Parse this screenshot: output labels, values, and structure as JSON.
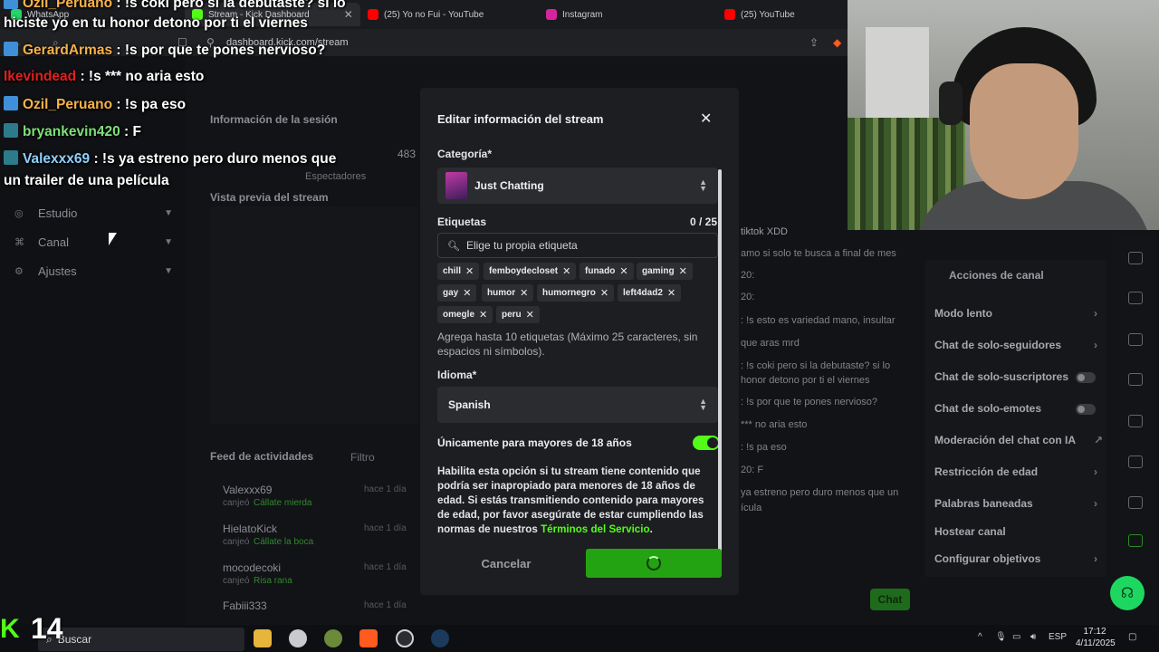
{
  "browser": {
    "tabs": [
      {
        "label": "WhatsApp",
        "color": "#25d366"
      },
      {
        "label": "Stream - Kick Dashboard",
        "color": "#53fc18"
      },
      {
        "label": "(25) Yo no Fui - YouTube",
        "color": "#ff0000"
      },
      {
        "label": "Instagram",
        "color": "#d6249f"
      },
      {
        "label": "(25) YouTube",
        "color": "#ff0000"
      }
    ],
    "url": "dashboard.kick.com/stream"
  },
  "overlay_chat": [
    {
      "user": "Ozil_Peruano",
      "user_color": "#f7b24a",
      "msg": ": !s coki pero si la debutaste? si lo",
      "badge": "blue"
    },
    {
      "cont": "hiciste yo en tu honor detono por ti el viernes"
    },
    {
      "user": "GerardArmas",
      "user_color": "#f7b24a",
      "msg": ": !s por que te pones nervioso?",
      "badge": "blue"
    },
    {
      "user": "Ikevindead",
      "user_color": "#e02020",
      "msg": ": !s *** no aria esto",
      "badge": ""
    },
    {
      "user": "Ozil_Peruano",
      "user_color": "#f7b24a",
      "msg": ": !s pa eso",
      "badge": "blue"
    },
    {
      "user": "bryankevin420",
      "user_color": "#7de07a",
      "msg": ": F",
      "badge": "teal"
    },
    {
      "user": "Valexxx69",
      "user_color": "#8fd0ff",
      "msg": ": !s ya estreno pero duro menos que",
      "badge": "teal"
    },
    {
      "cont": "un trailer de una película"
    }
  ],
  "dashboard": {
    "section_info": "Información de la sesión",
    "section_preview": "Vista previa del stream",
    "sidebar": [
      {
        "label": "Estudio"
      },
      {
        "label": "Canal"
      },
      {
        "label": "Ajustes"
      }
    ],
    "stats": {
      "viewers": "483",
      "label_spectators": "Espectadores"
    },
    "activity_title": "Feed de actividades",
    "activity_filter": "Filtro",
    "activity": [
      {
        "user": "Valexxx69",
        "action": "canjeó",
        "item": "Cállate mierda",
        "time": "hace 1 día"
      },
      {
        "user": "HielatoKick",
        "action": "canjeó",
        "item": "Cállate la boca",
        "time": "hace 1 día"
      },
      {
        "user": "mocodecoki",
        "action": "canjeó",
        "item": "Risa rana",
        "time": "hace 1 día"
      },
      {
        "user": "Fabiii333",
        "action": "",
        "item": "",
        "time": "hace 1 día"
      }
    ],
    "channel_actions_title": "Acciones de canal",
    "channel_actions": [
      {
        "label": "Modo lento",
        "type": "chevron"
      },
      {
        "label": "Chat de solo-seguidores",
        "type": "chevron"
      },
      {
        "label": "Chat de solo-suscriptores",
        "type": "toggle"
      },
      {
        "label": "Chat de solo-emotes",
        "type": "toggle"
      },
      {
        "label": "Moderación del chat con IA",
        "type": "link"
      },
      {
        "label": "Restricción de edad",
        "type": "chevron"
      },
      {
        "label": "Palabras baneadas",
        "type": "chevron"
      },
      {
        "label": "Hostear canal",
        "type": "none"
      },
      {
        "label": "Configurar objetivos",
        "type": "chevron"
      }
    ],
    "chat_lines": [
      "tiktok XDD",
      "amo si solo te busca a final de mes",
      "20:",
      "20:",
      ": !s esto es variedad mano, insultar",
      "que aras mrd",
      ": !s coki pero si la debutaste? si lo",
      "honor detono por ti el viernes",
      ": !s por que te pones nervioso?",
      "*** no aria esto",
      ": !s pa eso",
      "20: F",
      "ya estreno pero duro menos que un",
      "ícula"
    ],
    "chat_button": "Chat",
    "big_count": "14"
  },
  "modal": {
    "title": "Editar información del stream",
    "category_label": "Categoría*",
    "category_value": "Just Chatting",
    "tags_label": "Etiquetas",
    "tags_count": "0 / 25",
    "tags_placeholder": "Elige tu propia etiqueta",
    "tags": [
      "chill",
      "femboydecloset",
      "funado",
      "gaming",
      "gay",
      "humor",
      "humornegro",
      "left4dad2",
      "omegle",
      "peru"
    ],
    "tags_helper": "Agrega hasta 10 etiquetas (Máximo 25 caracteres, sin espacios ni símbolos).",
    "language_label": "Idioma*",
    "language_value": "Spanish",
    "age_label": "Únicamente para mayores de 18 años",
    "age_enabled": true,
    "age_desc": "Habilita esta opción si tu stream tiene contenido que podría ser inapropiado para menores de 18 años de edad. Si estás transmitiendo contenido para mayores de edad, por favor asegúrate de estar cumpliendo las normas de nuestros",
    "age_link": "Términos del Servicio",
    "age_desc_end": ".",
    "cancel": "Cancelar",
    "accent": "#53fc18"
  },
  "taskbar": {
    "search_placeholder": "Buscar",
    "lang": "ESP",
    "time": "17:12",
    "date": "4/11/2025"
  }
}
